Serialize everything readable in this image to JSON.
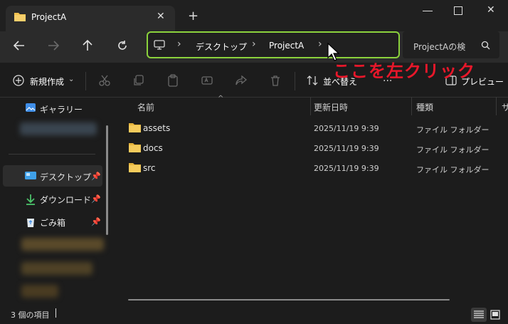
{
  "window": {
    "tab_title": "ProjectA",
    "new_tab": "+"
  },
  "nav": {
    "breadcrumb": [
      "デスクトップ",
      "ProjectA"
    ],
    "separator": "›",
    "search_placeholder": "ProjectAの検"
  },
  "toolbar": {
    "new_label": "新規作成",
    "sort_label": "並べ替え",
    "more_label": "...",
    "preview_label": "プレビュー"
  },
  "sidebar": {
    "items": [
      {
        "label": "ギャラリー",
        "icon": "gallery-icon"
      },
      {
        "label": "デスクトップ",
        "icon": "desktop-icon",
        "pinned": true,
        "selected": true
      },
      {
        "label": "ダウンロード",
        "icon": "download-icon",
        "pinned": true
      },
      {
        "label": "ごみ箱",
        "icon": "recycle-bin-icon",
        "pinned": true
      }
    ]
  },
  "columns": {
    "name": "名前",
    "date": "更新日時",
    "type": "種類",
    "extra": "サ"
  },
  "files": [
    {
      "name": "assets",
      "date": "2025/11/19 9:39",
      "type": "ファイル フォルダー"
    },
    {
      "name": "docs",
      "date": "2025/11/19 9:39",
      "type": "ファイル フォルダー"
    },
    {
      "name": "src",
      "date": "2025/11/19 9:39",
      "type": "ファイル フォルダー"
    }
  ],
  "status": {
    "item_count": "3 個の項目"
  },
  "annotation": {
    "text": "ここを左クリック",
    "color": "#e8172a"
  },
  "colors": {
    "highlight_border": "#8bd23c",
    "folder": "#f2c14e"
  }
}
